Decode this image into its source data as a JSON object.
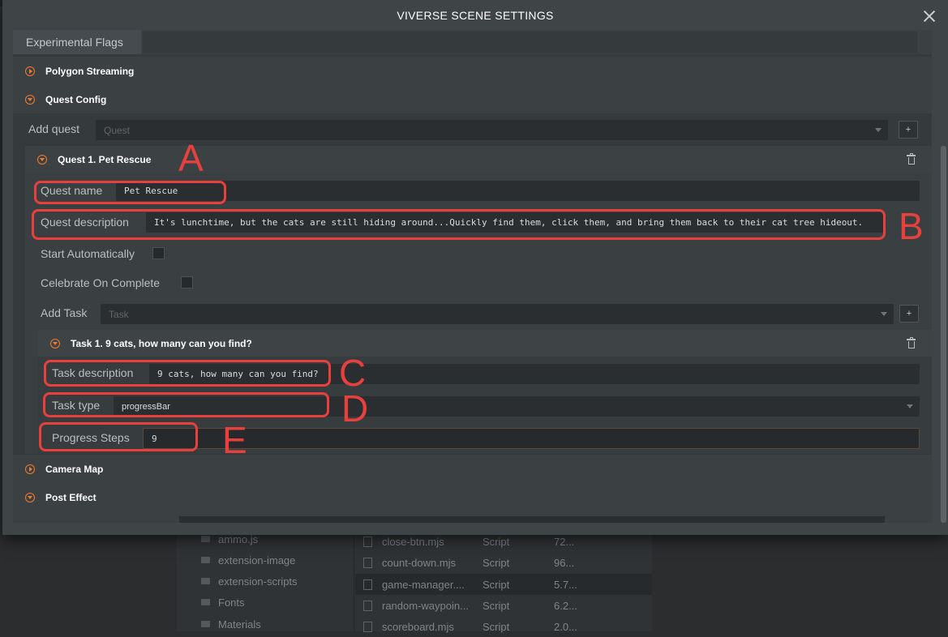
{
  "dialog": {
    "title": "VIVERSE SCENE SETTINGS"
  },
  "tabs": {
    "experimental": "Experimental Flags"
  },
  "sections": {
    "polygon_streaming": "Polygon Streaming",
    "quest_config": "Quest Config",
    "camera_map": "Camera Map",
    "post_effect": "Post Effect"
  },
  "quest_config": {
    "add_quest_label": "Add quest",
    "add_quest_placeholder": "Quest",
    "add_quest_button": "+",
    "quest": {
      "header": "Quest 1. Pet Rescue",
      "name_label": "Quest name",
      "name_value": "Pet Rescue",
      "description_label": "Quest description",
      "description_value": "It's lunchtime, but the cats are still hiding around...Quickly find them, click them, and bring them back to their cat tree hideout.",
      "start_auto_label": "Start Automatically",
      "start_auto_checked": false,
      "celebrate_label": "Celebrate On Complete",
      "celebrate_checked": false,
      "add_task_label": "Add Task",
      "add_task_placeholder": "Task",
      "add_task_button": "+",
      "task": {
        "header": "Task 1. 9 cats, how many can you find?",
        "description_label": "Task description",
        "description_value": "9 cats, how many can you find?",
        "type_label": "Task type",
        "type_value": "progressBar",
        "steps_label": "Progress Steps",
        "steps_value": "9"
      }
    }
  },
  "annotations": {
    "a": "A",
    "b": "B",
    "c": "C",
    "d": "D",
    "e": "E",
    "color": "#e8403c"
  },
  "accent_color": "#f37b2f",
  "background_panel": {
    "folders": [
      "ammo.js",
      "extension-image",
      "extension-scripts",
      "Fonts",
      "Materials"
    ],
    "files": [
      {
        "name": "close-btn.mjs",
        "type": "Script",
        "size": "72..."
      },
      {
        "name": "count-down.mjs",
        "type": "Script",
        "size": "96..."
      },
      {
        "name": "game-manager....",
        "type": "Script",
        "size": "5.7..."
      },
      {
        "name": "random-waypoin...",
        "type": "Script",
        "size": "6.2..."
      },
      {
        "name": "scoreboard.mjs",
        "type": "Script",
        "size": "2.0..."
      }
    ]
  }
}
